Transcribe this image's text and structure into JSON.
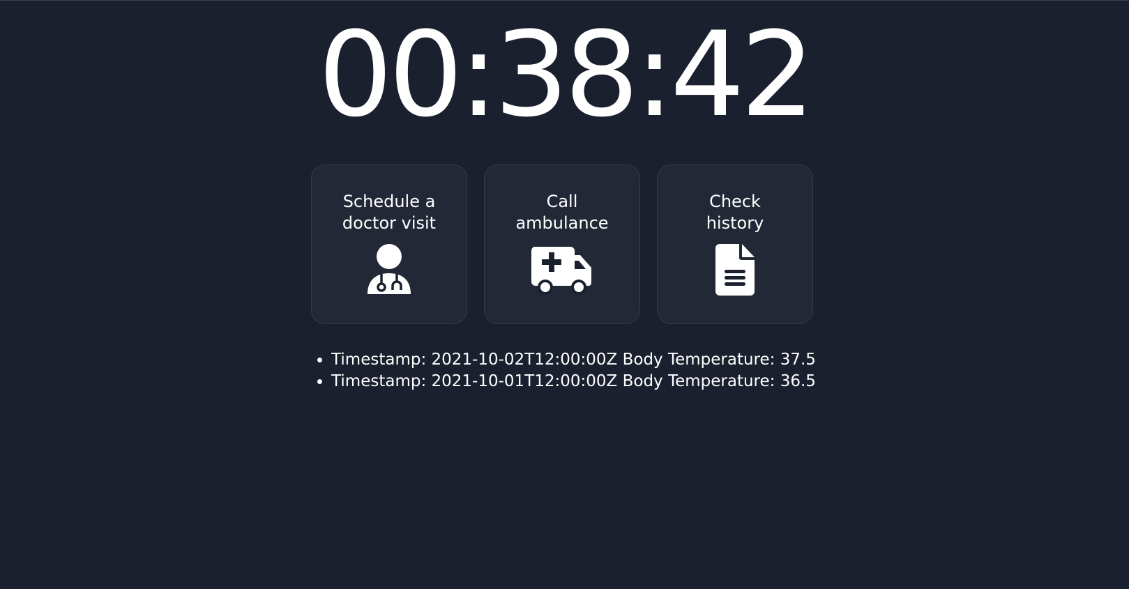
{
  "clock": {
    "time": "00:38:42"
  },
  "actions": [
    {
      "label": "Schedule a doctor visit",
      "icon": "doctor-icon"
    },
    {
      "label": "Call ambulance",
      "icon": "ambulance-icon"
    },
    {
      "label": "Check history",
      "icon": "document-icon"
    }
  ],
  "readings": [
    {
      "text": "Timestamp: 2021-10-02T12:00:00Z Body Temperature: 37.5"
    },
    {
      "text": "Timestamp: 2021-10-01T12:00:00Z Body Temperature: 36.5"
    }
  ],
  "colors": {
    "background": "#1a202d",
    "card": "#222836",
    "card_border": "#353c4a",
    "text": "#ffffff"
  }
}
